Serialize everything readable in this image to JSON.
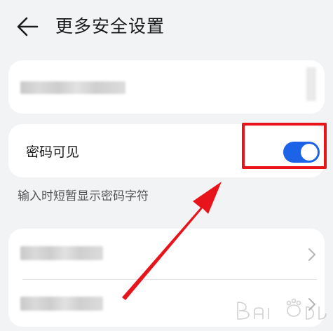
{
  "header": {
    "title": "更多安全设置",
    "back_icon": "arrow-left-icon"
  },
  "password_visible": {
    "label": "密码可见",
    "enabled": true,
    "hint": "输入时短暂显示密码字符"
  },
  "colors": {
    "background": "#f1f3f5",
    "card": "#ffffff",
    "switch_on": "#1d63e8",
    "annotation_red": "#e8141c"
  },
  "icons": {
    "chevron": "chevron-right-icon",
    "watermark": "baidu-watermark-icon"
  }
}
